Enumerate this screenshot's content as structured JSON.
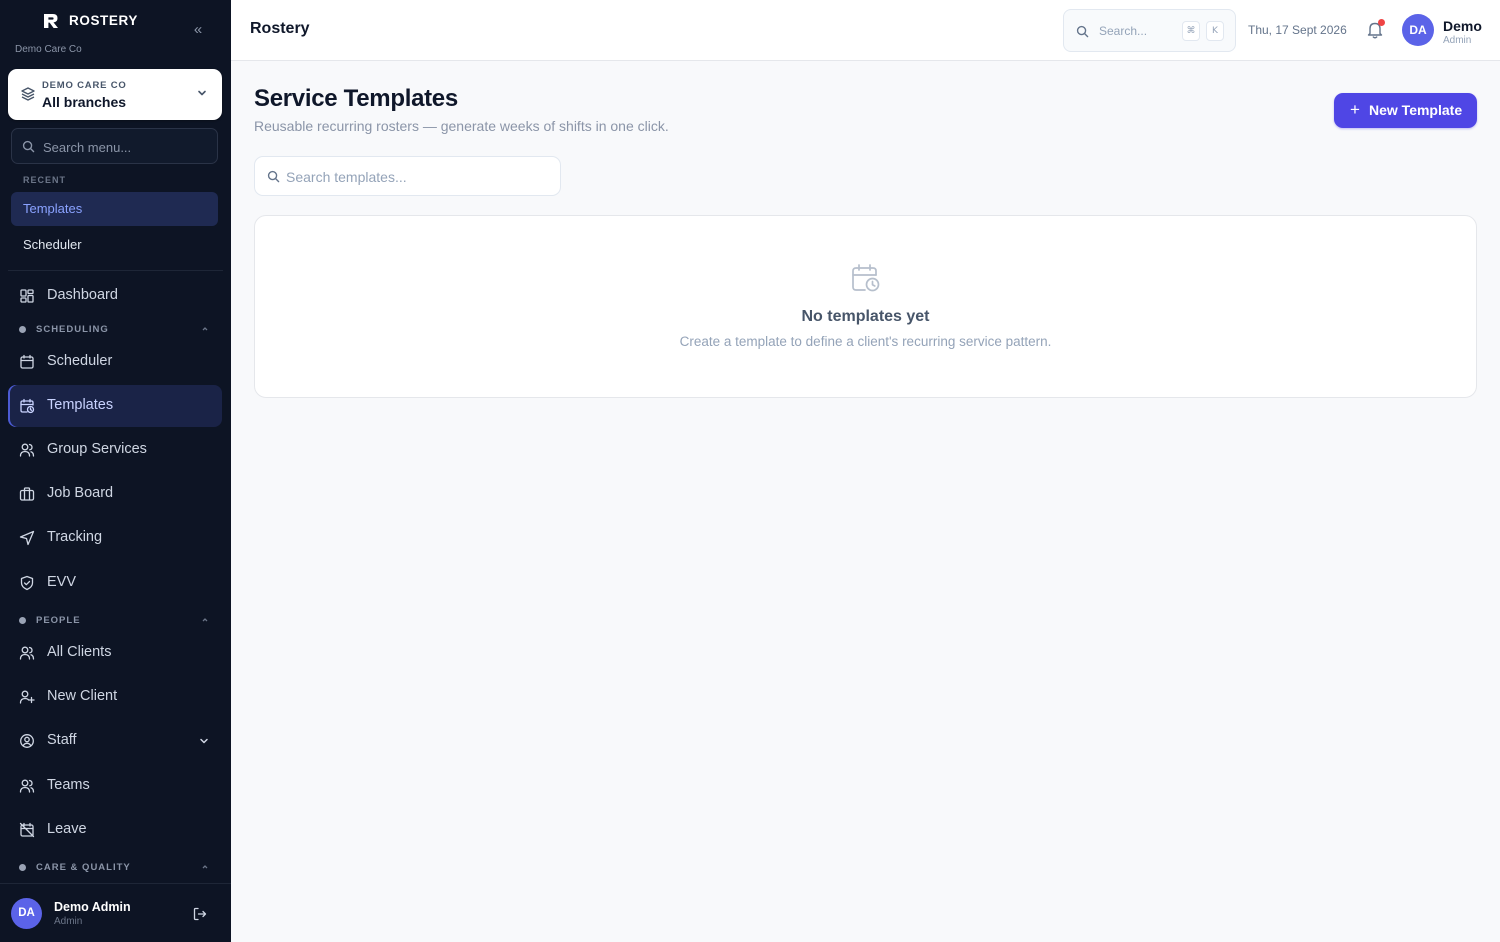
{
  "brand": {
    "name": "ROSTERY",
    "org_subtitle": "Demo Care Co"
  },
  "branch_selector": {
    "org": "DEMO CARE CO",
    "value": "All branches"
  },
  "menu_search": {
    "placeholder": "Search menu..."
  },
  "recent": {
    "label": "RECENT",
    "items": [
      {
        "label": "Templates",
        "active": true
      },
      {
        "label": "Scheduler",
        "active": false
      }
    ]
  },
  "nav": {
    "dashboard": "Dashboard",
    "sections": {
      "scheduling": "SCHEDULING",
      "people": "PEOPLE",
      "care_quality": "CARE & QUALITY"
    },
    "scheduler": "Scheduler",
    "templates": "Templates",
    "group_services": "Group Services",
    "job_board": "Job Board",
    "tracking": "Tracking",
    "evv": "EVV",
    "all_clients": "All Clients",
    "new_client": "New Client",
    "staff": "Staff",
    "teams": "Teams",
    "leave": "Leave"
  },
  "sidebar_user": {
    "initials": "DA",
    "name": "Demo Admin",
    "role": "Admin"
  },
  "topbar": {
    "title": "Rostery",
    "search_placeholder": "Search...",
    "shortcut_keys": [
      "⌘",
      "K"
    ],
    "date": "Thu, 17 Sept 2026",
    "user_initials": "DA",
    "user_name": "Demo",
    "user_role": "Admin"
  },
  "page": {
    "title": "Service Templates",
    "subtitle": "Reusable recurring rosters — generate weeks of shifts in one click.",
    "new_button": "New Template",
    "search_placeholder": "Search templates...",
    "empty_title": "No templates yet",
    "empty_description": "Create a template to define a client's recurring service pattern."
  },
  "colors": {
    "sidebar_bg": "#0d1424",
    "accent": "#4f46e5",
    "active_nav_bg": "#1a2347",
    "notification_dot": "#ef4444",
    "avatar": "#5b63e8"
  }
}
